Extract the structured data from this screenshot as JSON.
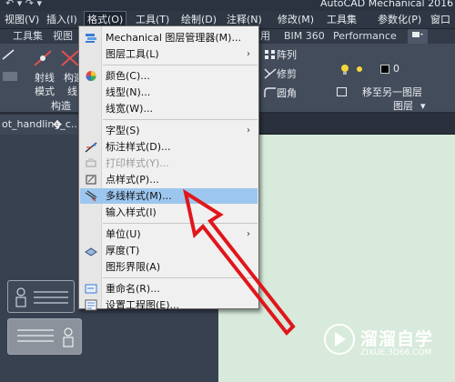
{
  "window": {
    "title": "AutoCAD Mechanical 2016",
    "quick_access": "↶ ▾ ↷ ▾"
  },
  "menubar": {
    "items": [
      "视图(V)",
      "插入(I)",
      "格式(O)",
      "工具(T)",
      "绘制(D)",
      "注释(N)",
      "修改(M)",
      "工具集",
      "参数化(P)",
      "窗口"
    ]
  },
  "ribbon_tabs": {
    "items": [
      "工具集",
      "视图",
      "用",
      "BIM 360",
      "Performance"
    ],
    "extra_icon": "tab-options-icon"
  },
  "ribbon": {
    "left_labels": [
      "射线",
      "构造",
      "模式",
      "线"
    ],
    "left_panel_title": "构造",
    "modify_labels": [
      "阵列",
      "修剪",
      "圆角"
    ],
    "layer_label": "移至另一图层",
    "layer_value": "0",
    "layer_panel_title": "图层",
    "panel_dropdown_arrow": "▾"
  },
  "file_tab": {
    "label": "ot_handling_c..."
  },
  "format_menu": {
    "items": [
      {
        "label": "Mechanical 图层管理器(M)...",
        "icon": "layer-manager-icon",
        "submenu": false,
        "disabled": false
      },
      {
        "label": "图层工具(L)",
        "icon": "",
        "submenu": true,
        "disabled": false
      },
      {
        "label": "颜色(C)...",
        "icon": "color-wheel-icon",
        "submenu": false,
        "disabled": false
      },
      {
        "label": "线型(N)...",
        "icon": "",
        "submenu": false,
        "disabled": false
      },
      {
        "label": "线宽(W)...",
        "icon": "",
        "submenu": false,
        "disabled": false
      },
      {
        "label": "字型(S)",
        "icon": "",
        "submenu": true,
        "disabled": false
      },
      {
        "label": "标注样式(D)...",
        "icon": "dimension-style-icon",
        "submenu": false,
        "disabled": false
      },
      {
        "label": "打印样式(Y)...",
        "icon": "plot-style-icon",
        "submenu": false,
        "disabled": true
      },
      {
        "label": "点样式(P)...",
        "icon": "point-style-icon",
        "submenu": false,
        "disabled": false
      },
      {
        "label": "多线样式(M)...",
        "icon": "multiline-style-icon",
        "submenu": false,
        "disabled": false,
        "highlighted": true
      },
      {
        "label": "输入样式(I)",
        "icon": "",
        "submenu": false,
        "disabled": false
      },
      {
        "label": "单位(U)",
        "icon": "",
        "submenu": true,
        "disabled": false
      },
      {
        "label": "厚度(T)",
        "icon": "thickness-icon",
        "submenu": false,
        "disabled": false
      },
      {
        "label": "图形界限(A)",
        "icon": "",
        "submenu": false,
        "disabled": false
      },
      {
        "label": "重命名(R)...",
        "icon": "rename-icon",
        "submenu": false,
        "disabled": false
      },
      {
        "label": "设置工程图(E)...",
        "icon": "drawing-setup-icon",
        "submenu": false,
        "disabled": false
      }
    ],
    "submenu_arrow": "›"
  },
  "watermark": {
    "title": "溜溜自学",
    "url": "ZIXUE.3D66.COM"
  },
  "colors": {
    "accent_arrow": "#e0161b",
    "menu_highlight": "#9cc6ee",
    "canvas_green": "#d7eadb"
  }
}
